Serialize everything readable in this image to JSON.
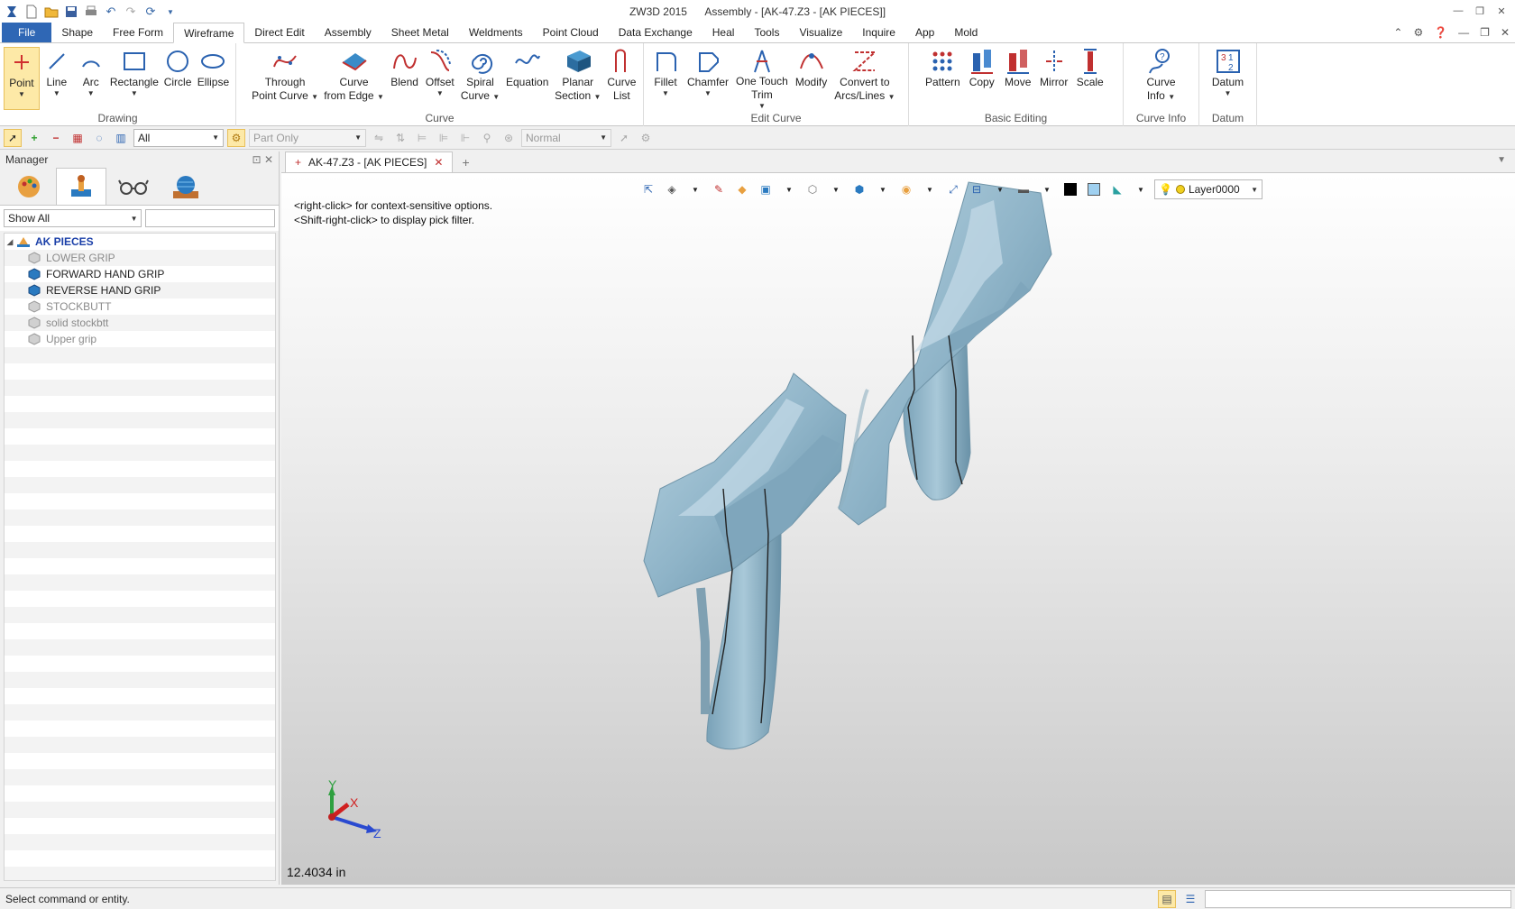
{
  "window": {
    "app": "ZW3D 2015",
    "title": "Assembly - [AK-47.Z3 - [AK PIECES]]"
  },
  "menu": {
    "tabs": [
      "File",
      "Shape",
      "Free Form",
      "Wireframe",
      "Direct Edit",
      "Assembly",
      "Sheet Metal",
      "Weldments",
      "Point Cloud",
      "Data Exchange",
      "Heal",
      "Tools",
      "Visualize",
      "Inquire",
      "App",
      "Mold"
    ],
    "active": "Wireframe"
  },
  "ribbon": {
    "drawing": {
      "label": "Drawing",
      "point": "Point",
      "line": "Line",
      "arc": "Arc",
      "rectangle": "Rectangle",
      "circle": "Circle",
      "ellipse": "Ellipse"
    },
    "curve": {
      "label": "Curve",
      "through_point_curve_1": "Through",
      "through_point_curve_2": "Point Curve",
      "curve_from_edge_1": "Curve",
      "curve_from_edge_2": "from Edge",
      "blend": "Blend",
      "offset": "Offset",
      "spiral_1": "Spiral",
      "spiral_2": "Curve",
      "equation": "Equation",
      "planar_section_1": "Planar",
      "planar_section_2": "Section",
      "curve_list_1": "Curve",
      "curve_list_2": "List"
    },
    "edit_curve": {
      "label": "Edit Curve",
      "fillet": "Fillet",
      "chamfer": "Chamfer",
      "one_touch_trim_1": "One Touch",
      "one_touch_trim_2": "Trim",
      "modify": "Modify",
      "convert_1": "Convert to",
      "convert_2": "Arcs/Lines"
    },
    "basic_editing": {
      "label": "Basic Editing",
      "pattern": "Pattern",
      "copy": "Copy",
      "move": "Move",
      "mirror": "Mirror",
      "scale": "Scale"
    },
    "curve_info": {
      "label": "Curve Info",
      "btn_1": "Curve",
      "btn_2": "Info"
    },
    "datum": {
      "label": "Datum",
      "btn": "Datum"
    }
  },
  "toolbar2": {
    "filter_value": "All",
    "pick_value": "Part Only",
    "mode_value": "Normal"
  },
  "manager": {
    "title": "Manager",
    "filter_value": "Show All",
    "filter_search": "",
    "tree": {
      "root": "AK PIECES",
      "items": [
        {
          "label": "LOWER GRIP",
          "active": false
        },
        {
          "label": "FORWARD HAND GRIP",
          "active": true
        },
        {
          "label": "REVERSE HAND GRIP",
          "active": true
        },
        {
          "label": "STOCKBUTT",
          "active": false
        },
        {
          "label": "solid stockbtt",
          "active": false
        },
        {
          "label": "Upper grip",
          "active": false
        }
      ]
    }
  },
  "document": {
    "tab_label": "AK-47.Z3 - [AK PIECES]"
  },
  "viewport": {
    "layer": "Layer0000",
    "hint_1": "<right-click> for context-sensitive options.",
    "hint_2": "<Shift-right-click> to display pick filter.",
    "measure": "12.4034 in",
    "axis_x": "X",
    "axis_y": "Y",
    "axis_z": "Z",
    "model_color": "#8fb4c8"
  },
  "status": {
    "text": "Select command or entity."
  }
}
